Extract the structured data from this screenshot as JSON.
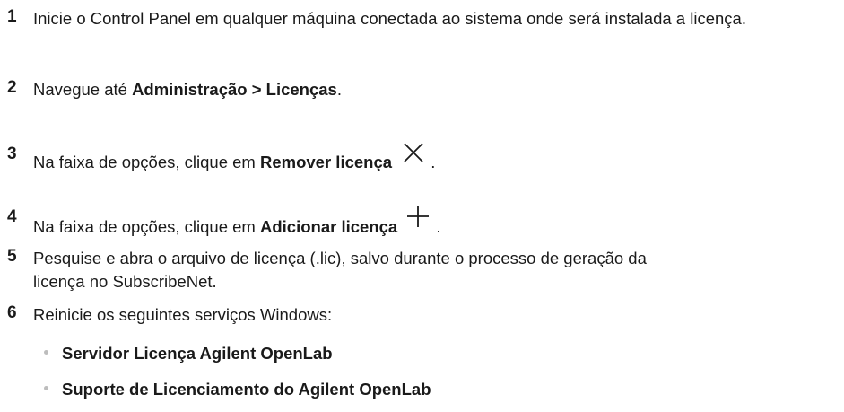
{
  "steps": [
    {
      "number": "1",
      "text": "Inicie o Control Panel em qualquer máquina conectada ao sistema onde será instalada a licença."
    },
    {
      "number": "2",
      "prefix": "Navegue até ",
      "bold": "Administração > Licenças",
      "suffix": "."
    },
    {
      "number": "3",
      "prefix": "Na faixa de opções, clique em ",
      "bold": "Remover licença",
      "icon": "close-icon",
      "suffix": "."
    },
    {
      "number": "4",
      "prefix": "Na faixa de opções, clique em ",
      "bold": "Adicionar licença",
      "icon": "plus-icon",
      "suffix": "."
    },
    {
      "number": "5",
      "text": "Pesquise e abra o arquivo de licença (.lic), salvo durante o processo de geração da licença no SubscribeNet."
    },
    {
      "number": "6",
      "text": "Reinicie os seguintes serviços Windows:"
    }
  ],
  "services": [
    "Servidor Licença Agilent OpenLab",
    "Suporte de Licenciamento do Agilent OpenLab"
  ],
  "colors": {
    "text": "#1a1a1a",
    "bullet": "#bdbdbd"
  }
}
